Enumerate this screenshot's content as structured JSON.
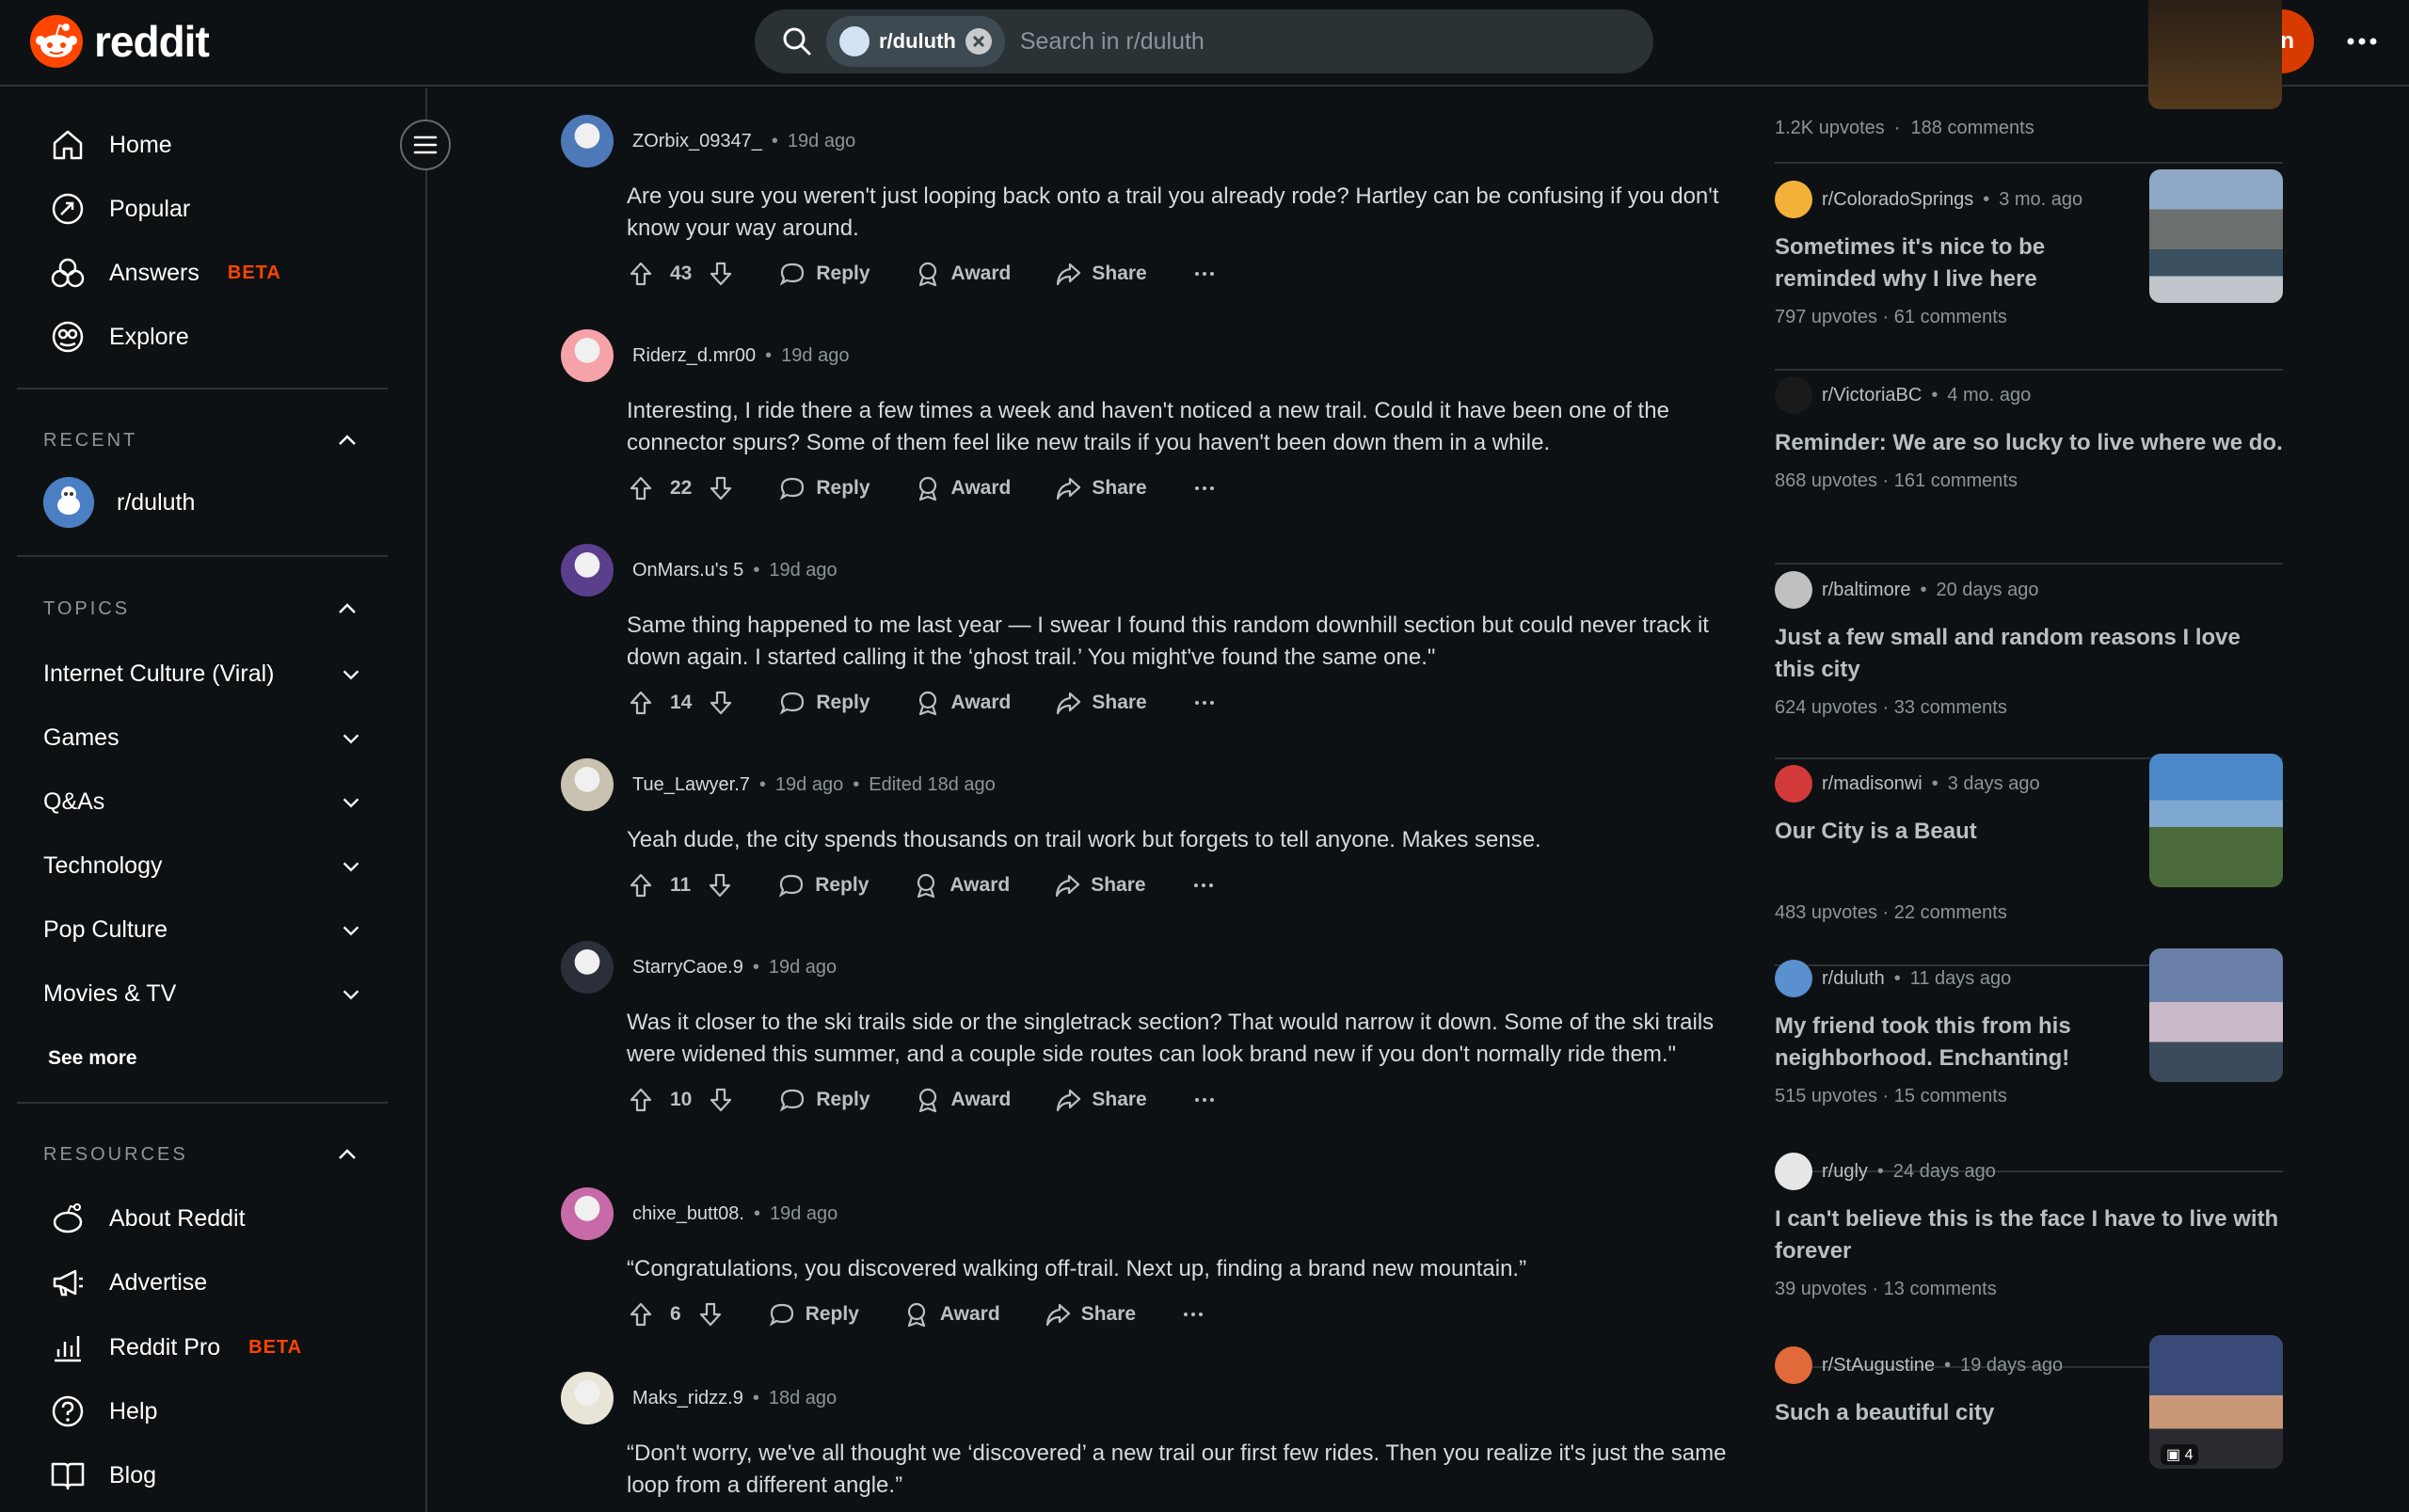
{
  "brand": {
    "name": "reddit",
    "accent": "#ff4500"
  },
  "header": {
    "search_chip": "r/duluth",
    "search_placeholder": "Search in r/duluth",
    "login_label": "Log In"
  },
  "sidebar": {
    "nav": [
      {
        "label": "Home",
        "icon": "home-icon"
      },
      {
        "label": "Popular",
        "icon": "popular-icon"
      },
      {
        "label": "Answers",
        "icon": "answers-icon",
        "badge": "BETA"
      },
      {
        "label": "Explore",
        "icon": "explore-icon"
      }
    ],
    "recent_heading": "RECENT",
    "recent": [
      {
        "label": "r/duluth"
      }
    ],
    "topics_heading": "TOPICS",
    "topics": [
      "Internet Culture (Viral)",
      "Games",
      "Q&As",
      "Technology",
      "Pop Culture",
      "Movies & TV"
    ],
    "see_more": "See more",
    "resources_heading": "RESOURCES",
    "resources": [
      {
        "label": "About Reddit",
        "icon": "reddit-alien-icon"
      },
      {
        "label": "Advertise",
        "icon": "megaphone-icon"
      },
      {
        "label": "Reddit Pro",
        "icon": "bar-chart-icon",
        "badge": "BETA"
      },
      {
        "label": "Help",
        "icon": "help-icon"
      },
      {
        "label": "Blog",
        "icon": "book-icon"
      }
    ]
  },
  "actions": {
    "reply": "Reply",
    "award": "Award",
    "share": "Share"
  },
  "comments": [
    {
      "user": "ZOrbix_09347_",
      "time": "19d ago",
      "edited": "",
      "body": "Are you sure you weren't just looping back onto a trail you already rode? Hartley can be confusing if you don't know your way around.",
      "score": "43"
    },
    {
      "user": "Riderz_d.mr00",
      "time": "19d ago",
      "edited": "",
      "body": "Interesting, I ride there a few times a week and haven't noticed a new trail. Could it have been one of the connector spurs? Some of them feel like new trails if you haven't been down them in a while.",
      "score": "22"
    },
    {
      "user": "OnMars.u's 5",
      "time": "19d ago",
      "edited": "",
      "body": "Same thing happened to me last year — I swear I found this random downhill section but could never track it down again. I started calling it the ‘ghost trail.’ You might've found the same one.\"",
      "score": "14"
    },
    {
      "user": "Tue_Lawyer.7",
      "time": "19d ago",
      "edited": "Edited 18d ago",
      "body": "Yeah dude, the city spends thousands on trail work but forgets to tell anyone. Makes sense.",
      "score": "11"
    },
    {
      "user": "StarryCaoe.9",
      "time": "19d ago",
      "edited": "",
      "body": "Was it closer to the ski trails side or the singletrack section? That would narrow it down. Some of the ski trails were widened this summer, and a couple side routes can look brand new if you don't normally ride them.\"",
      "score": "10"
    },
    {
      "user": "chixe_butt08.",
      "time": "19d ago",
      "edited": "",
      "body": "“Congratulations, you discovered walking off-trail. Next up, finding a brand new mountain.”",
      "score": "6"
    },
    {
      "user": "Maks_ridzz.9",
      "time": "18d ago",
      "edited": "",
      "body": "“Don't worry, we've all thought we ‘discovered’ a new trail our first few rides. Then you realize it's just the same loop from a different angle.”",
      "score": ""
    }
  ],
  "related": {
    "top_stats": {
      "upvotes": "1.2K upvotes",
      "comments": "188 comments"
    },
    "posts": [
      {
        "sub": "r/ColoradoSprings",
        "age": "3 mo. ago",
        "title": "Sometimes it's nice to be reminded why I live here",
        "upvotes": "797 upvotes",
        "comments": "61 comments",
        "thumb": true
      },
      {
        "sub": "r/VictoriaBC",
        "age": "4 mo. ago",
        "title": "Reminder: We are so lucky to live where we do.",
        "upvotes": "868 upvotes",
        "comments": "161 comments",
        "thumb": false
      },
      {
        "sub": "r/baltimore",
        "age": "20 days ago",
        "title": "Just a few small and random reasons I love this city",
        "upvotes": "624 upvotes",
        "comments": "33 comments",
        "thumb": false
      },
      {
        "sub": "r/madisonwi",
        "age": "3 days ago",
        "title": "Our City is a Beaut",
        "upvotes": "483 upvotes",
        "comments": "22 comments",
        "thumb": true
      },
      {
        "sub": "r/duluth",
        "age": "11 days ago",
        "title": "My friend took this from his neighborhood. Enchanting!",
        "upvotes": "515 upvotes",
        "comments": "15 comments",
        "thumb": true
      },
      {
        "sub": "r/ugly",
        "age": "24 days ago",
        "title": "I can't believe this is the face I have to live with forever",
        "upvotes": "39 upvotes",
        "comments": "13 comments",
        "thumb": false
      },
      {
        "sub": "r/StAugustine",
        "age": "19 days ago",
        "title": "Such a beautiful city",
        "upvotes": "",
        "comments": "",
        "thumb": true,
        "gallery_count": "4"
      }
    ]
  }
}
